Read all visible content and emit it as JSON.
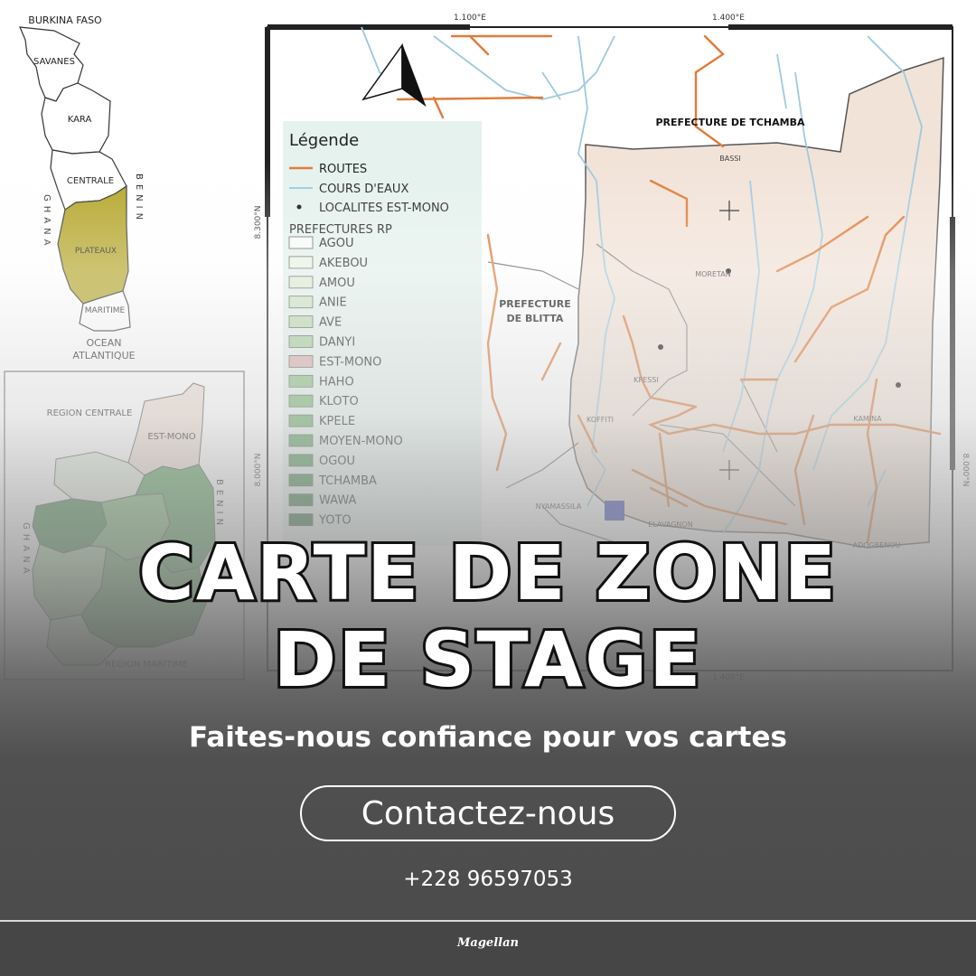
{
  "colors": {
    "roads": "#e07b39",
    "rivers": "#9ec9e0",
    "est_mono": "#f1e1d6",
    "plateaux": "#b5a62a",
    "legend_bg": "#e4f1ec",
    "location_square": "#3340b8",
    "bottom_band": "#4a4a4a"
  },
  "inset_togo": {
    "neighbors": {
      "north": "BURKINA FASO",
      "west": "GHANA",
      "east": "BENIN",
      "south_line1": "OCEAN",
      "south_line2": "ATLANTIQUE"
    },
    "regions": [
      "SAVANES",
      "KARA",
      "CENTRALE",
      "PLATEAUX",
      "MARITIME"
    ]
  },
  "inset_plateaux": {
    "labels": {
      "north": "REGION CENTRALE",
      "highlight": "EST-MONO",
      "west": "GHANA",
      "east": "BENIN",
      "south": "REGION MARITIME"
    }
  },
  "main_map": {
    "grid": {
      "lon_left": "1.100°E",
      "lon_right": "1.400°E",
      "lat_top": "8.300°N",
      "lat_bottom": "8.000°N"
    },
    "labels": {
      "pref_north": "PREFECTURE DE TCHAMBA",
      "pref_west_line1": "PREFECTURE",
      "pref_west_line2": "DE BLITTA",
      "towns": [
        "BASSI",
        "MORETAN",
        "KPESSI",
        "KOFFITI",
        "KAMINA",
        "NYAMASSILA",
        "ELAVAGNON",
        "ADOGBENOU"
      ]
    },
    "legend": {
      "title": "Légende",
      "layers": [
        {
          "symbol": "line",
          "label": "ROUTES"
        },
        {
          "symbol": "river",
          "label": "COURS D'EAUX"
        },
        {
          "symbol": "point",
          "label": "LOCALITES EST-MONO"
        }
      ],
      "group_title": "PREFECTURES RP",
      "prefectures": [
        {
          "label": "AGOU",
          "color": "#f7fbf6"
        },
        {
          "label": "AKEBOU",
          "color": "#e9f4e4"
        },
        {
          "label": "AMOU",
          "color": "#dcedd5"
        },
        {
          "label": "ANIE",
          "color": "#cde5c4"
        },
        {
          "label": "AVE",
          "color": "#bcdcb1"
        },
        {
          "label": "DANYI",
          "color": "#a9d09e"
        },
        {
          "label": "EST-MONO",
          "color": "#dcb0b0"
        },
        {
          "label": "HAHO",
          "color": "#8cc283"
        },
        {
          "label": "KLOTO",
          "color": "#7ab873"
        },
        {
          "label": "KPELE",
          "color": "#68ad66"
        },
        {
          "label": "MOYEN-MONO",
          "color": "#56a05a"
        },
        {
          "label": "OGOU",
          "color": "#4a944f"
        },
        {
          "label": "TCHAMBA",
          "color": "#3f8646"
        },
        {
          "label": "WAWA",
          "color": "#35783d"
        },
        {
          "label": "YOTO",
          "color": "#2c6a35"
        }
      ]
    }
  },
  "promo": {
    "headline_line1": "CARTE DE ZONE",
    "headline_line2": "DE STAGE",
    "tagline": "Faites-nous confiance pour vos cartes",
    "cta_label": "Contactez-nous",
    "phone": "+228 96597053",
    "brand": "Magellan"
  }
}
